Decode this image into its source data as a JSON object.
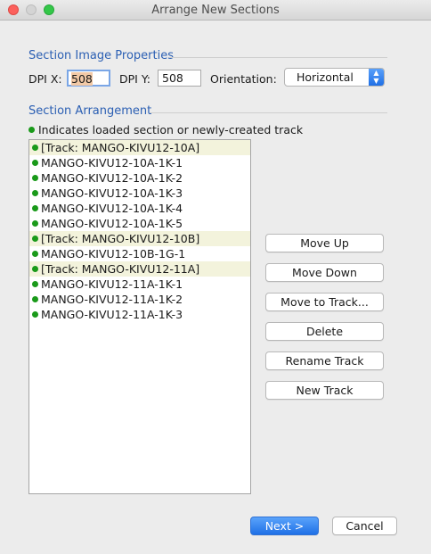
{
  "window": {
    "title": "Arrange New Sections"
  },
  "image_properties": {
    "header": "Section Image Properties",
    "dpi_x_label": "DPI X:",
    "dpi_x_value": "508",
    "dpi_y_label": "DPI Y:",
    "dpi_y_value": "508",
    "orientation_label": "Orientation:",
    "orientation_value": "Horizontal"
  },
  "arrangement": {
    "header": "Section Arrangement",
    "legend": "Indicates loaded section or newly-created track",
    "items": [
      {
        "label": "[Track: MANGO-KIVU12-10A]",
        "track": true
      },
      {
        "label": "MANGO-KIVU12-10A-1K-1",
        "track": false
      },
      {
        "label": "MANGO-KIVU12-10A-1K-2",
        "track": false
      },
      {
        "label": "MANGO-KIVU12-10A-1K-3",
        "track": false
      },
      {
        "label": "MANGO-KIVU12-10A-1K-4",
        "track": false
      },
      {
        "label": "MANGO-KIVU12-10A-1K-5",
        "track": false
      },
      {
        "label": "[Track: MANGO-KIVU12-10B]",
        "track": true
      },
      {
        "label": "MANGO-KIVU12-10B-1G-1",
        "track": false
      },
      {
        "label": "[Track: MANGO-KIVU12-11A]",
        "track": true
      },
      {
        "label": "MANGO-KIVU12-11A-1K-1",
        "track": false
      },
      {
        "label": "MANGO-KIVU12-11A-1K-2",
        "track": false
      },
      {
        "label": "MANGO-KIVU12-11A-1K-3",
        "track": false
      }
    ]
  },
  "actions": {
    "move_up": "Move Up",
    "move_down": "Move Down",
    "move_to_track": "Move to Track...",
    "delete": "Delete",
    "rename_track": "Rename Track",
    "new_track": "New Track"
  },
  "footer": {
    "next": "Next >",
    "cancel": "Cancel"
  },
  "colors": {
    "accent": "#2b5fb3",
    "loaded_dot": "#1a9a1a",
    "track_row": "#f3f3dc",
    "default_button": "#1f70e6"
  }
}
